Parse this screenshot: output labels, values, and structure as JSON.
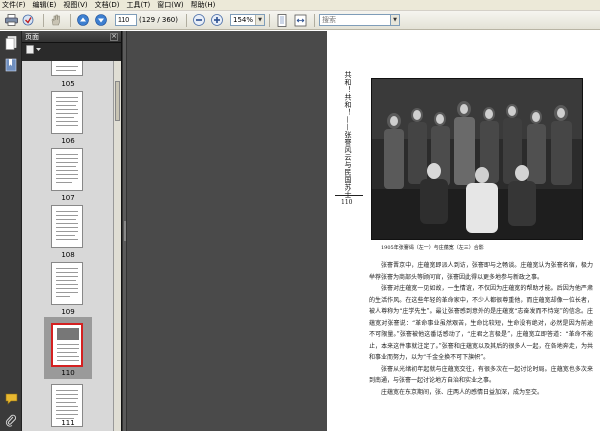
{
  "menubar": {
    "items": [
      "文件(F)",
      "编辑(E)",
      "视图(V)",
      "文档(D)",
      "工具(T)",
      "窗口(W)",
      "帮助(H)"
    ]
  },
  "toolbar": {
    "page_number": "110",
    "page_count": "(129 / 360)",
    "zoom": "154%",
    "search_placeholder": "搜索"
  },
  "pages_panel": {
    "title": "页面",
    "close": "×",
    "selected_page": "110",
    "thumbnails": [
      {
        "label": "105"
      },
      {
        "label": "106"
      },
      {
        "label": "107"
      },
      {
        "label": "108"
      },
      {
        "label": "109"
      },
      {
        "label": "110"
      },
      {
        "label": "111"
      }
    ]
  },
  "document": {
    "vertical_title": "共和！共和！——张謇风云与民国苏士",
    "vertical_subtitle": "张謇风云与民国苏士",
    "page_number": "110",
    "photo_caption": "1905年张謇谒（左一）与庄蕴宽（左三）合影",
    "paragraphs": [
      "张謇晋京中，庄蕴宽即派人到访，张謇即与之畅谈。庄蕴宽认为张謇名宿，极力举荐张謇为商部头等顾问官，张謇因此得以更多地参与新政之事。",
      "张謇对庄蕴宽一见如故，一生情谊，不仅因为庄蕴宽的帮助才能。后因为他严肃的生活作风。在这些年轻的革命家中，不少人都很尊重他，而庄蕴宽却像一位长者，被人尊称为“庄学先生”。最让张謇感到意外的是庄蕴宽“志奋发而不恃宠”的信念。庄蕴宽对张謇说：“革命事业虽然艰苦，生命比较短，生命没有绝对，必然是因为前途不可限量。”张謇被他这番话感动了，“庄君之言极是”，庄蕴宽立即答道：“革命不能止，本来这件事就注定了。”张謇和庄蕴宽以及其后的很多人一起，在各地奔走，为共和事业而努力，以为“千金全换不可下旗帜”。",
      "张謇从光绪初年起就与庄蕴宽交往，有很多次在一起讨论时局。庄蕴宽也多次来到南通，与张謇一起讨论地方自治和实业之事。",
      "庄蕴宽在东京期间，张、庄两人的感情日益加深，成为至交。"
    ]
  },
  "colors": {
    "selection_border": "#d42020",
    "doc_background": "#4a4a4a",
    "panel_background": "#2a2a2a"
  },
  "icons": {
    "print": "printer-icon",
    "email": "email-icon",
    "prev": "arrow-up-icon",
    "next": "arrow-down-icon",
    "zoom_out": "zoom-out-icon",
    "zoom_in": "zoom-in-icon",
    "fit_page": "fit-page-icon",
    "fit_width": "fit-width-icon",
    "pages": "pages-icon",
    "bookmarks": "bookmark-icon",
    "comments": "comment-icon",
    "attachments": "paperclip-icon"
  }
}
